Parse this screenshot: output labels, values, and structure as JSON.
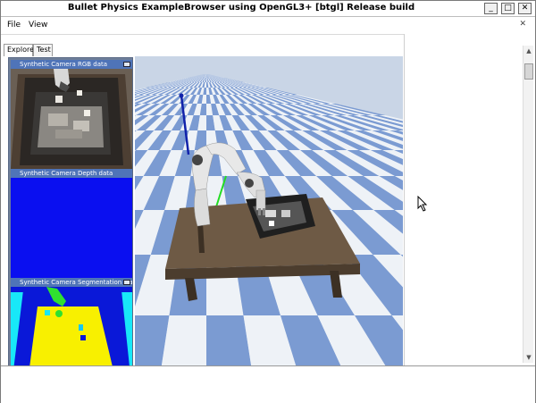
{
  "window": {
    "title": "Bullet Physics ExampleBrowser using OpenGL3+ [btgl] Release build",
    "minimize_label": "_",
    "maximize_label": "□",
    "close_label": "✕"
  },
  "menu": {
    "items": [
      "File",
      "View"
    ],
    "close_label": "✕"
  },
  "tabs": [
    "Explorer",
    "Test"
  ],
  "panels": {
    "rgb_title": "Synthetic Camera RGB data",
    "depth_title": "Synthetic Camera Depth data",
    "seg_title": "Synthetic Camera Segmentation Mask"
  },
  "colors": {
    "panel_header": "#4f74b8",
    "depth_blue": "#0a0ff0",
    "seg_cyan": "#18e8f8",
    "seg_yellow": "#f8f000",
    "seg_green": "#30e030",
    "sky": "#c9d5e6",
    "checker_blue": "#7b9bd2",
    "checker_white": "#eef2f7",
    "table_top": "#6e5a45"
  },
  "icons": {
    "cursor": "mouse-pointer-icon",
    "scroll_up": "chevron-up-icon",
    "scroll_down": "chevron-down-icon"
  }
}
